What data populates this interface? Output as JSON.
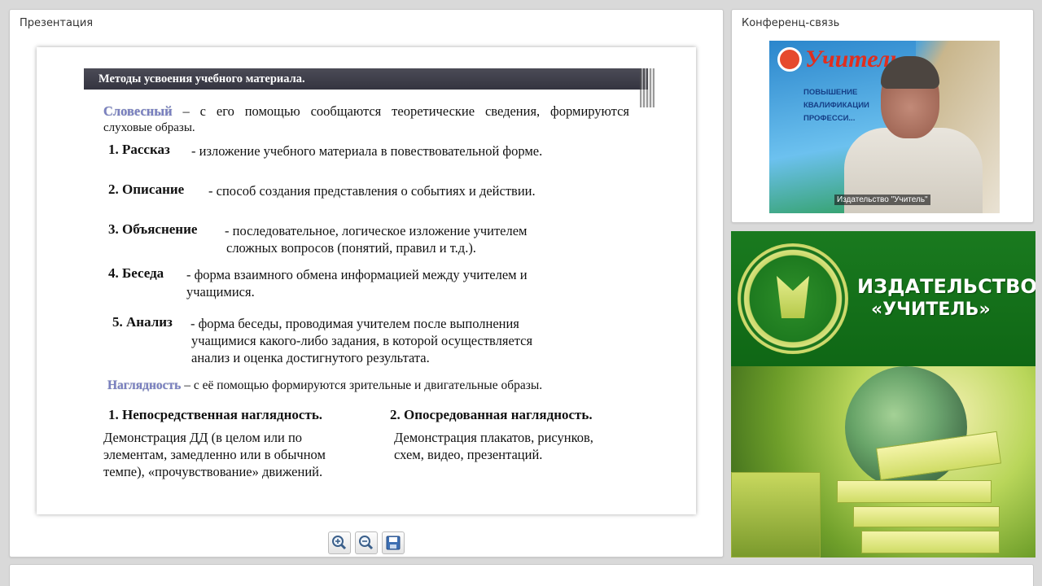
{
  "presentation_panel": {
    "title": "Презентация",
    "slide": {
      "header": "Методы усвоения учебного материала.",
      "verbal": {
        "term": "Словесный",
        "text": " – с его помощью сообщаются теоретические сведения, формируются",
        "text2": "слуховые образы."
      },
      "items": [
        {
          "label": "1. Рассказ",
          "text": "- изложение учебного материала в повествовательной форме."
        },
        {
          "label": "2. Описание",
          "text": "- способ создания представления о событиях и действии."
        },
        {
          "label": "3. Объяснение",
          "text1": "-   последовательное,   логическое   изложение   учителем",
          "text2": "сложных вопросов (понятий, правил и т.д.)."
        },
        {
          "label": "4. Беседа",
          "text1": "-  форма  взаимного  обмена  информацией  между  учителем  и",
          "text2": "учащимися."
        },
        {
          "label": "5. Анализ",
          "text1": "-  форма  беседы,  проводимая  учителем  после  выполнения",
          "text2": "учащимися  какого-либо  задания,  в  которой  осуществляется",
          "text3": "анализ и оценка достигнутого результата."
        }
      ],
      "visual": {
        "term": "Наглядность",
        "text": " – с её помощью формируются зрительные и двигательные образы."
      },
      "direct": {
        "title": "1. Непосредственная наглядность.",
        "line1": "Демонстрация  ДД  (в  целом  или  по",
        "line2": "элементам,  замедленно  или  в  обычном",
        "line3": "темпе), «прочувствование» движений."
      },
      "indirect": {
        "title": "2. Опосредованная наглядность.",
        "line1": "Демонстрация плакатов, рисунков,",
        "line2": "схем, видео, презентаций."
      }
    },
    "toolbar": {
      "zoom_in_icon": "zoom-in-icon",
      "zoom_out_icon": "zoom-out-icon",
      "save_icon": "save-icon"
    }
  },
  "conference_panel": {
    "title": "Конференц-связь",
    "video_caption": "Издательство \"Учитель\"",
    "poster": {
      "title": "Учитель",
      "line1": "ПОВЫШЕНИЕ",
      "line2": "КВАЛИФИКАЦИИ",
      "line3": "ПРОФЕССИ..."
    }
  },
  "banner": {
    "line1": "ИЗДАТЕЛЬСТВО",
    "line2": "«УЧИТЕЛЬ»"
  },
  "colors": {
    "background": "#d9d9d9",
    "slide_header": "#3f3f4b",
    "term_highlight": "#7a7fc0",
    "banner_green": "#1a7a1f"
  }
}
